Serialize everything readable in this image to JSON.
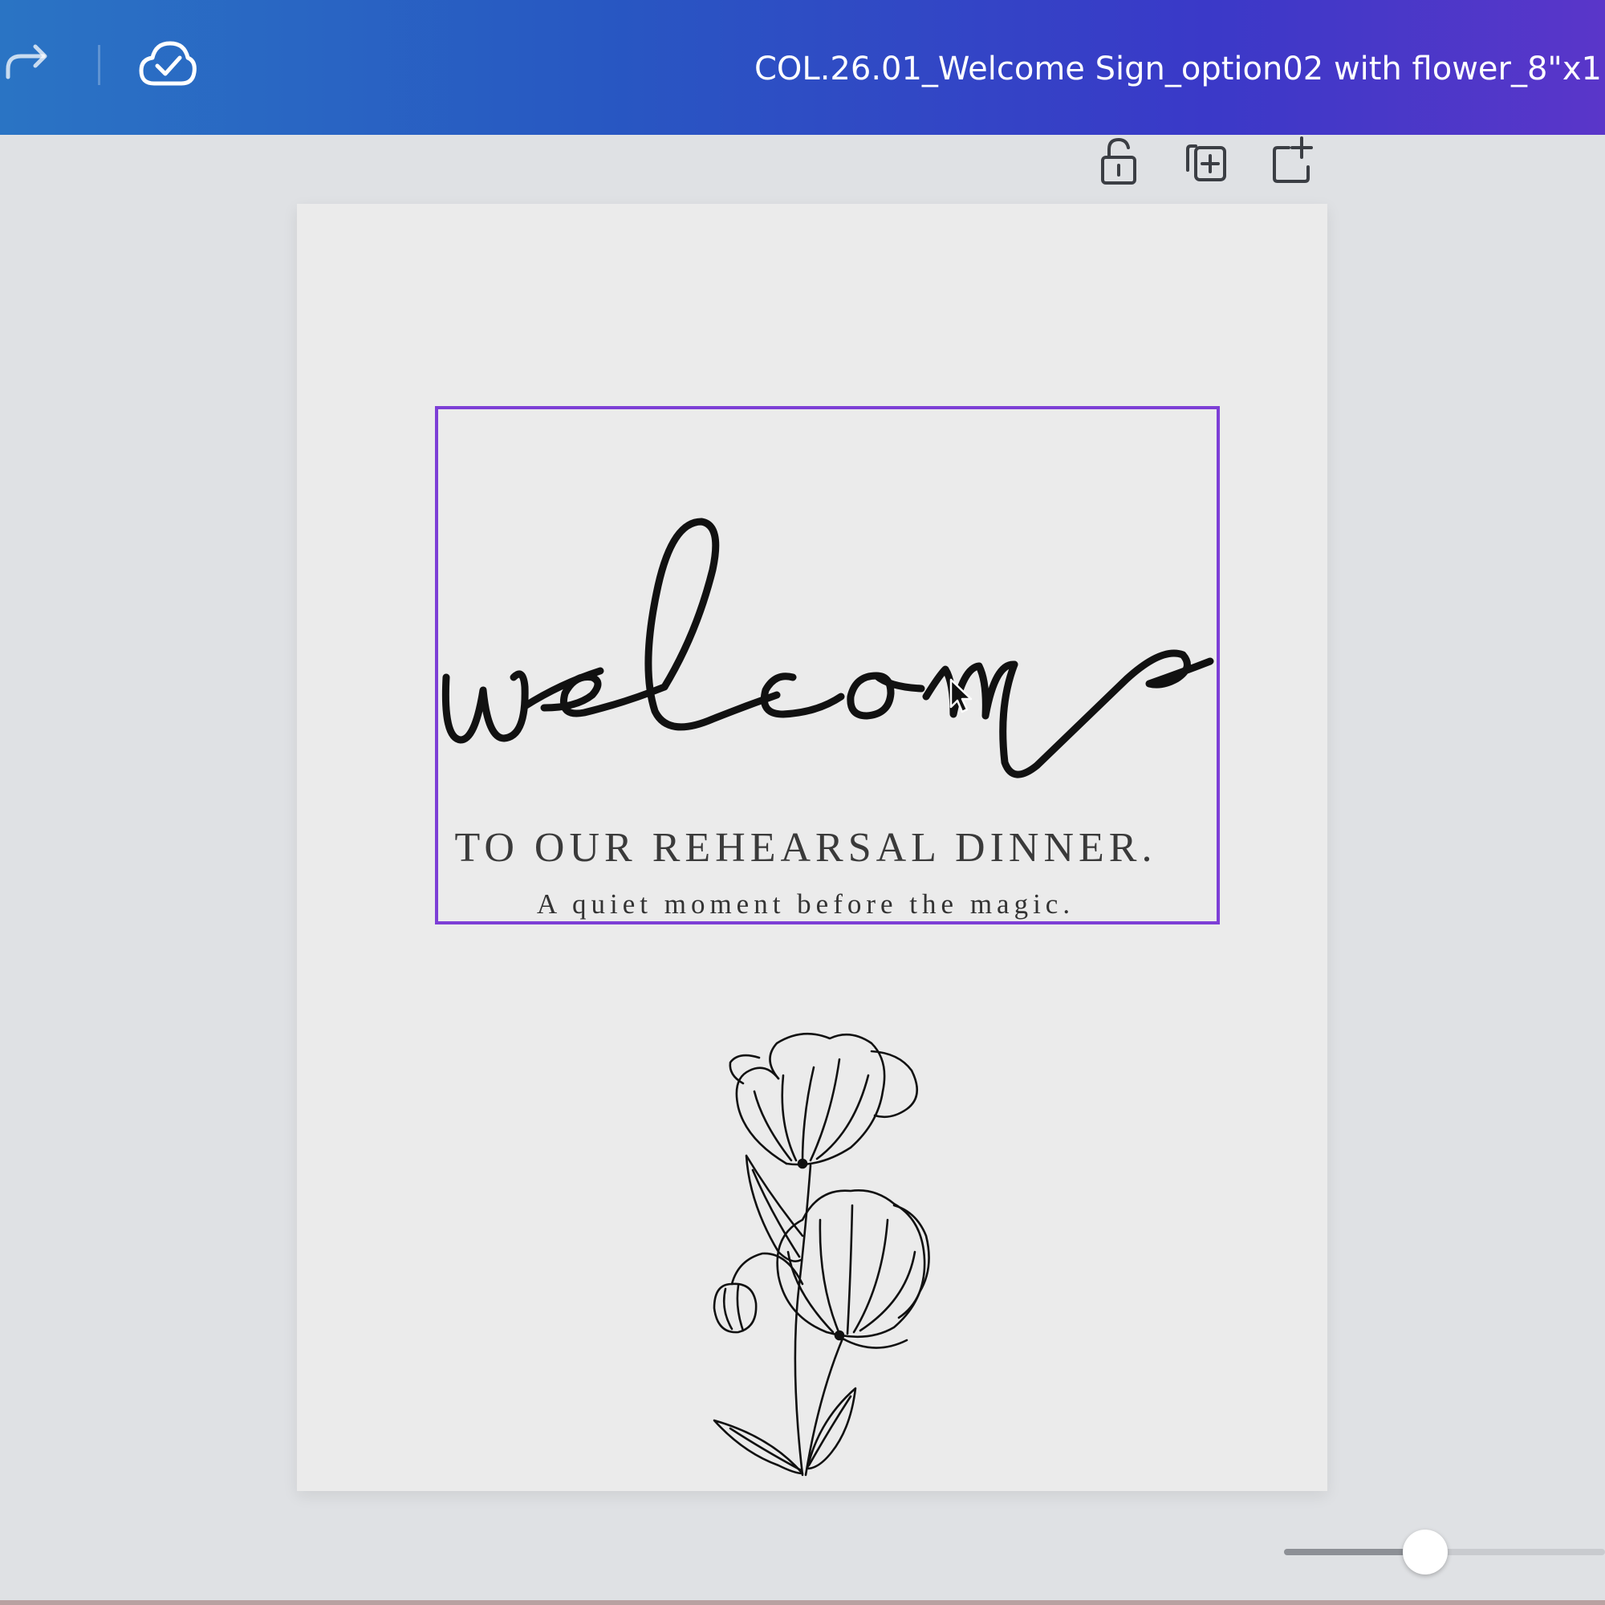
{
  "topbar": {
    "document_title": "COL.26.01_Welcome Sign_option02 with flower_8\"x1",
    "redo_icon": "redo-icon",
    "save_status_icon": "cloud-check-icon",
    "gradient_colors": [
      "#2a74c4",
      "#3a39c8",
      "#5a36c9"
    ]
  },
  "page_toolbar": {
    "icons": [
      "lock-open-icon",
      "duplicate-page-icon",
      "add-page-icon"
    ]
  },
  "design": {
    "script_word": "welcome",
    "headline": "TO OUR REHEARSAL DINNER.",
    "tagline": "A quiet moment before the magic.",
    "selection_color": "#7d3fd6",
    "illustration": "poppy-flower-line-art"
  },
  "zoom": {
    "level": 0.44
  }
}
